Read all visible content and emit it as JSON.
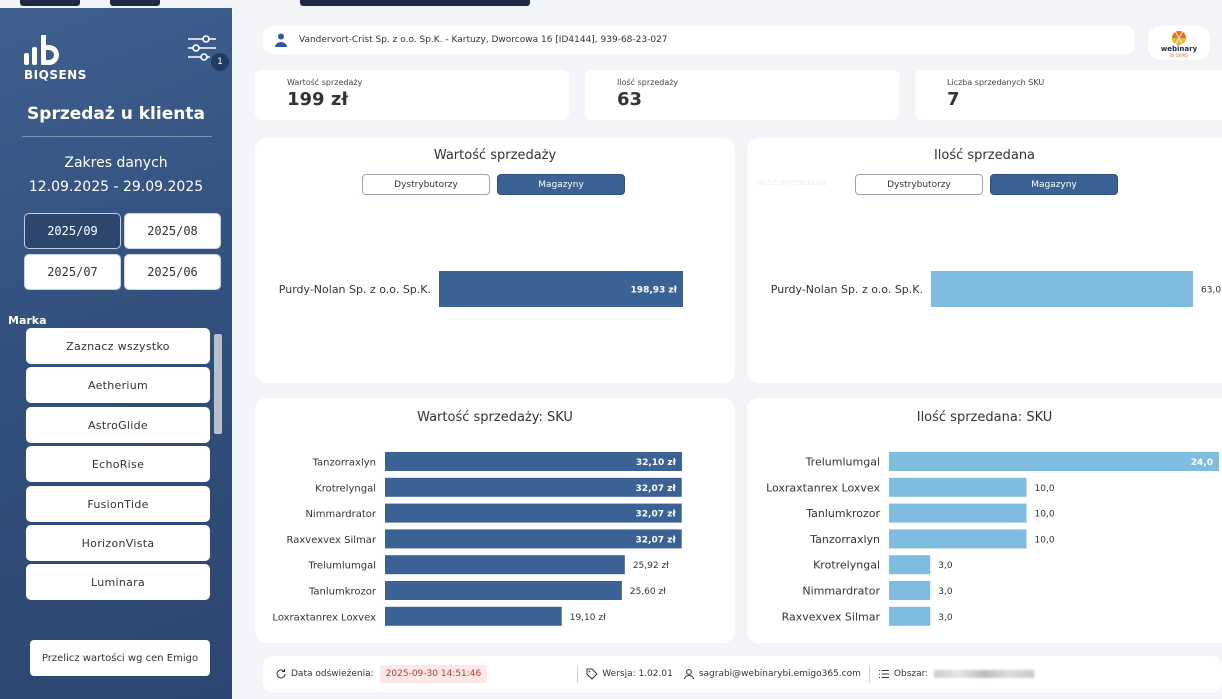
{
  "sidebar": {
    "brand": "BIQSENS",
    "filter_badge": "1",
    "title": "Sprzedaż u klienta",
    "range_label": "Zakres danych",
    "range_value": "12.09.2025 - 29.09.2025",
    "periods": [
      {
        "label": "2025/09",
        "active": true
      },
      {
        "label": "2025/08",
        "active": false
      },
      {
        "label": "2025/07",
        "active": false
      },
      {
        "label": "2025/06",
        "active": false
      }
    ],
    "marka_label": "Marka",
    "brands": [
      "Zaznacz wszystko",
      "Aetherium",
      "AstroGlide",
      "EchoRise",
      "FusionTide",
      "HorizonVista",
      "Luminara"
    ],
    "recalc_button": "Przelicz wartości wg cen Emigo"
  },
  "header": {
    "client": "Vandervort-Crist Sp. z o.o. Sp.K. - Kartuzy, Dworcowa 16 [ID4144], 939-68-23-027",
    "logo_text": "webinary",
    "logo_sub": "BI DEMO"
  },
  "kpis": [
    {
      "label": "Wartość sprzedaży",
      "value": "199 zł"
    },
    {
      "label": "Ilość sprzedaży",
      "value": "63"
    },
    {
      "label": "Liczba sprzedanych SKU",
      "value": "7"
    }
  ],
  "cards": {
    "sales_value": {
      "title": "Wartość sprzedaży",
      "toggle_off": "Dystrybutorzy",
      "toggle_on": "Magazyny"
    },
    "qty_sold": {
      "title": "Ilość sprzedana",
      "ghost_label": "Ilość sprzedana",
      "toggle_off": "Dystrybutorzy",
      "toggle_on": "Magazyny"
    },
    "sku_value": {
      "title": "Wartość sprzedaży: SKU"
    },
    "sku_qty": {
      "title": "Ilość sprzedana: SKU"
    }
  },
  "chart_data": [
    {
      "type": "bar",
      "orientation": "horizontal",
      "title": "Wartość sprzedaży",
      "categories": [
        "Purdy-Nolan Sp. z o.o. Sp.K."
      ],
      "values": [
        198.93
      ],
      "value_labels": [
        "198,93 zł"
      ],
      "color": "#3a6294"
    },
    {
      "type": "bar",
      "orientation": "horizontal",
      "title": "Ilość sprzedana",
      "categories": [
        "Purdy-Nolan Sp. z o.o. Sp.K."
      ],
      "values": [
        63.0
      ],
      "value_labels": [
        "63,0"
      ],
      "color": "#7fbde0"
    },
    {
      "type": "bar",
      "orientation": "horizontal",
      "title": "Wartość sprzedaży: SKU",
      "categories": [
        "Tanzorraxlyn",
        "Krotrelyngal",
        "Nimmardrator",
        "Raxvexvex Silmar",
        "Trelumlumgal",
        "Tanlumkrozor",
        "Loxraxtanrex Loxvex"
      ],
      "values": [
        32.1,
        32.07,
        32.07,
        32.07,
        25.92,
        25.6,
        19.1
      ],
      "value_labels": [
        "32,10 zł",
        "32,07 zł",
        "32,07 zł",
        "32,07 zł",
        "25,92 zł",
        "25,60 zł",
        "19,10 zł"
      ],
      "color": "#3a6294"
    },
    {
      "type": "bar",
      "orientation": "horizontal",
      "title": "Ilość sprzedana: SKU",
      "categories": [
        "Trelumlumgal",
        "Loxraxtanrex Loxvex",
        "Tanlumkrozor",
        "Tanzorraxlyn",
        "Krotrelyngal",
        "Nimmardrator",
        "Raxvexvex Silmar"
      ],
      "values": [
        24.0,
        10.0,
        10.0,
        10.0,
        3.0,
        3.0,
        3.0
      ],
      "value_labels": [
        "24,0",
        "10,0",
        "10,0",
        "10,0",
        "3,0",
        "3,0",
        "3,0"
      ],
      "color": "#7fbde0"
    }
  ],
  "footer": {
    "refresh_label": "Data odświeżenia:",
    "refresh_value": "2025-09-30 14:51:46",
    "version_label": "Wersja: 1.02.01",
    "user": "sagrabi@webinarybi.emigo365.com",
    "area_label": "Obszar:"
  }
}
